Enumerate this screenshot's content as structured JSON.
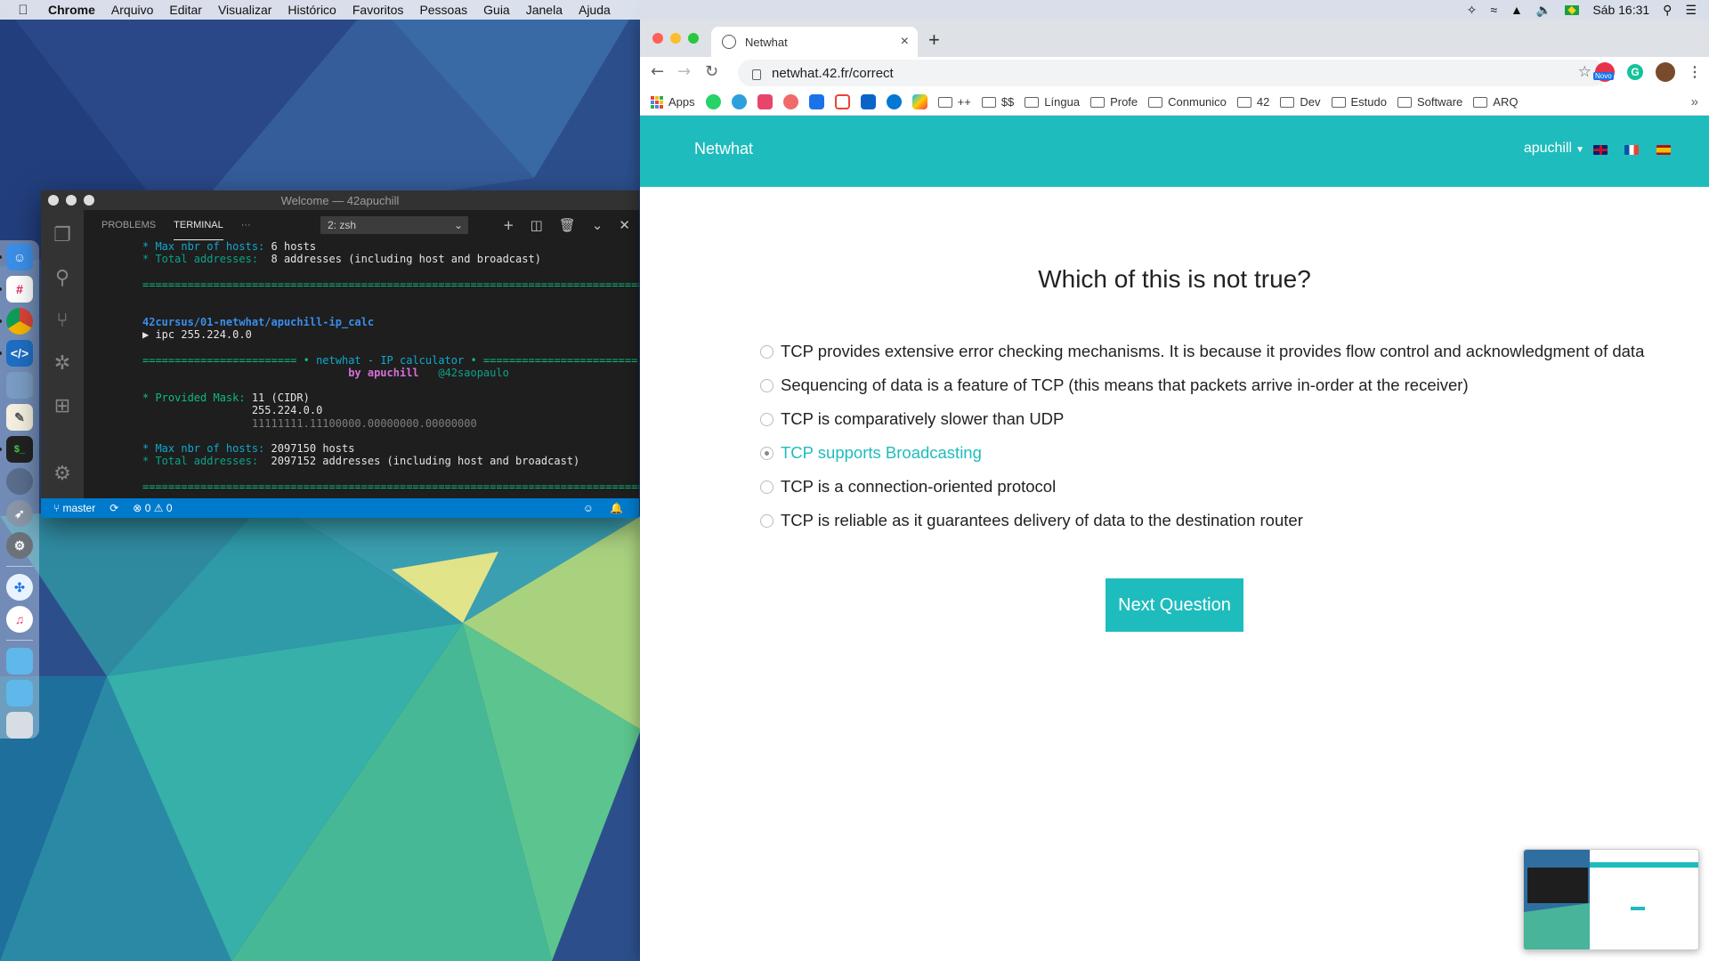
{
  "menubar": {
    "app_name": "Chrome",
    "items": [
      "Arquivo",
      "Editar",
      "Visualizar",
      "Histórico",
      "Favoritos",
      "Pessoas",
      "Guia",
      "Janela",
      "Ajuda"
    ],
    "clock": "Sáb 16:31"
  },
  "vscode": {
    "title": "Welcome — 42apuchill",
    "tabs": {
      "problems": "PROBLEMS",
      "terminal": "TERMINAL",
      "more": "···"
    },
    "terminal_select": "2: zsh",
    "status": {
      "branch": "master",
      "errors": "0",
      "warnings": "0"
    },
    "terminal": {
      "l1_label": "* Max nbr of hosts:",
      "l1_value": "6 hosts",
      "l2_label": "* Total addresses:",
      "l2_value": "8 addresses (including host and broadcast)",
      "rule": "=================================================================================",
      "path": "42cursus/01-netwhat/apuchill-ip_calc",
      "prompt": "▶ ipc 255.224.0.0",
      "banner_left": "======================== •",
      "banner_title": " netwhat - IP calculator ",
      "banner_right": "• ========================",
      "byline": "by apuchill",
      "handle": "@42saopaulo",
      "mask_label": "* Provided Mask:",
      "mask_value": "11 (CIDR)",
      "mask_dotted": "255.224.0.0",
      "mask_binary": "11111111.11100000.00000000.00000000",
      "l3_label": "* Max nbr of hosts:",
      "l3_value": "2097150 hosts",
      "l4_label": "* Total addresses:",
      "l4_value": "2097152 addresses (including host and broadcast)"
    }
  },
  "chrome": {
    "tab_title": "Netwhat",
    "url": "netwhat.42.fr/correct",
    "ext_badge": "Novo",
    "bookmarks": [
      "Apps",
      "++",
      "$$",
      "Língua",
      "Profe",
      "Conmunico",
      "42",
      "Dev",
      "Estudo",
      "Software",
      "ARQ"
    ],
    "bookmark_more": "»"
  },
  "site": {
    "brand": "Netwhat",
    "user": "apuchill",
    "question": "Which of this is not true?",
    "answers": [
      "TCP provides extensive error checking mechanisms. It is because it provides flow control and acknowledgment of data",
      "Sequencing of data is a feature of TCP (this means that packets arrive in-order at the receiver)",
      "TCP is comparatively slower than UDP",
      "TCP supports Broadcasting",
      "TCP is a connection-oriented protocol",
      "TCP is reliable as it guarantees delivery of data to the destination router"
    ],
    "selected_answer": 3,
    "next_button": "Next Question"
  },
  "colors": {
    "accent": "#1fbcbd",
    "vscode_status": "#007acc"
  }
}
